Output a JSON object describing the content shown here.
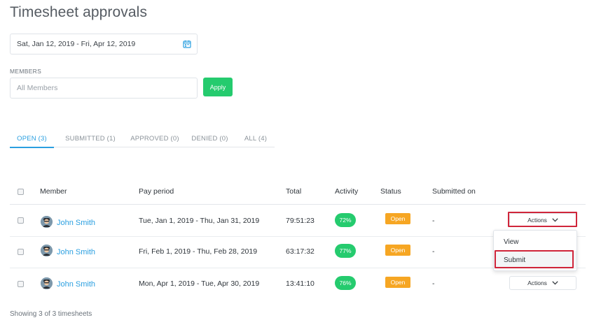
{
  "page": {
    "title": "Timesheet approvals"
  },
  "filters": {
    "date_range": "Sat, Jan 12, 2019 - Fri, Apr 12, 2019",
    "members_label": "MEMBERS",
    "members_placeholder": "All Members",
    "apply_label": "Apply"
  },
  "tabs": [
    {
      "label": "OPEN (3)",
      "active": true
    },
    {
      "label": "SUBMITTED (1)",
      "active": false
    },
    {
      "label": "APPROVED (0)",
      "active": false
    },
    {
      "label": "DENIED (0)",
      "active": false
    },
    {
      "label": "ALL (4)",
      "active": false
    }
  ],
  "table": {
    "headers": {
      "member": "Member",
      "pay_period": "Pay period",
      "total": "Total",
      "activity": "Activity",
      "status": "Status",
      "submitted_on": "Submitted on"
    },
    "rows": [
      {
        "member": "John Smith",
        "pay_period": "Tue, Jan 1, 2019 - Thu, Jan 31, 2019",
        "total": "79:51:23",
        "activity": "72%",
        "status": "Open",
        "submitted_on": "-",
        "actions_label": "Actions"
      },
      {
        "member": "John Smith",
        "pay_period": "Fri, Feb 1, 2019 - Thu, Feb 28, 2019",
        "total": "63:17:32",
        "activity": "77%",
        "status": "Open",
        "submitted_on": "-",
        "actions_label": "Actions"
      },
      {
        "member": "John Smith",
        "pay_period": "Mon, Apr 1, 2019 - Tue, Apr 30, 2019",
        "total": "13:41:10",
        "activity": "76%",
        "status": "Open",
        "submitted_on": "-",
        "actions_label": "Actions"
      }
    ]
  },
  "actions_menu": {
    "items": [
      {
        "label": "View"
      },
      {
        "label": "Submit"
      }
    ]
  },
  "footer": {
    "summary": "Showing 3 of 3 timesheets"
  },
  "colors": {
    "accent": "#2a9fe0",
    "apply_button": "#25cb6e",
    "activity_pill": "#25cb6e",
    "status_open": "#f6a623",
    "highlight": "#d0253a"
  },
  "icons": {
    "date_picker": "calendar-icon",
    "actions_toggle": "chevron-down-icon",
    "member_avatar": "avatar"
  }
}
